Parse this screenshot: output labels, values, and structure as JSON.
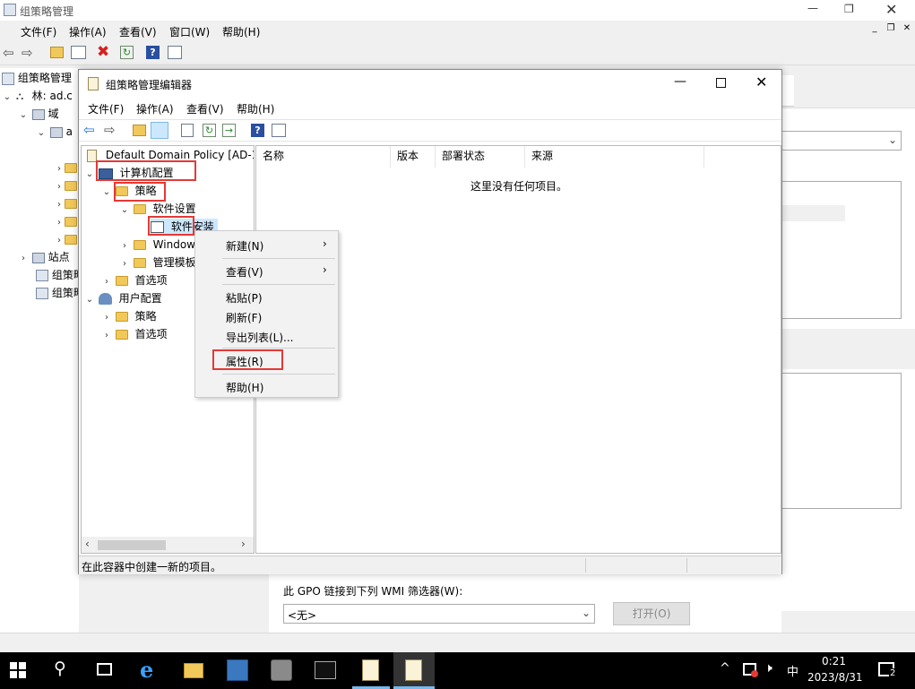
{
  "outer": {
    "title": "组策略管理",
    "menu": [
      "文件(F)",
      "操作(A)",
      "查看(V)",
      "窗口(W)",
      "帮助(H)"
    ],
    "tree": {
      "root": "组策略管理",
      "forest": "林: ad.c",
      "domains": "域",
      "domain_a": "a",
      "sites": "站点",
      "item1": "组策略",
      "item2": "组策略"
    },
    "wmi_label": "此 GPO 链接到下列 WMI 筛选器(W):",
    "wmi_value": "<无>",
    "open_button": "打开(O)"
  },
  "editor": {
    "title": "组策略管理编辑器",
    "menu": [
      "文件(F)",
      "操作(A)",
      "查看(V)",
      "帮助(H)"
    ],
    "tree": {
      "policy": "Default Domain Policy [AD-1.",
      "computer_config": "计算机配置",
      "policies": "策略",
      "software_settings": "软件设置",
      "software_install": "软件安装",
      "windows": "Window",
      "admin_templates": "管理模板",
      "preferences": "首选项",
      "user_config": "用户配置",
      "user_policies": "策略",
      "user_preferences": "首选项"
    },
    "columns": [
      "名称",
      "版本",
      "部署状态",
      "来源"
    ],
    "empty_text": "这里没有任何项目。",
    "status": "在此容器中创建一新的项目。"
  },
  "context_menu": {
    "new": "新建(N)",
    "view": "查看(V)",
    "paste": "粘贴(P)",
    "refresh": "刷新(F)",
    "export": "导出列表(L)...",
    "properties": "属性(R)",
    "help": "帮助(H)"
  },
  "taskbar": {
    "ime": "中",
    "time": "0:21",
    "date": "2023/8/31",
    "notif_count": "2"
  },
  "colors": {
    "highlight": "#cce8ff",
    "redbox": "#e53935",
    "taskbar": "#000000"
  }
}
